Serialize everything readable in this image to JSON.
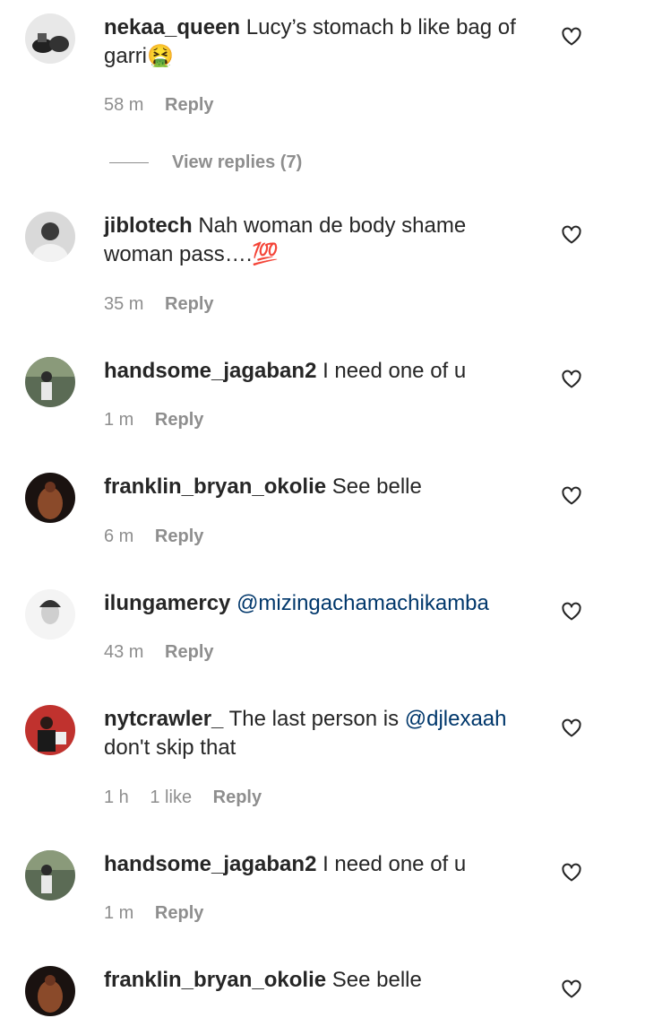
{
  "comments": [
    {
      "username": "nekaa_queen",
      "text": "Lucy’s stomach b like bag of garri🤮",
      "time": "58 m",
      "reply": "Reply"
    },
    {
      "username": "jiblotech",
      "text": "Nah woman de body shame woman pass….💯",
      "time": "35 m",
      "reply": "Reply"
    },
    {
      "username": "handsome_jagaban2",
      "text": "I need one of u",
      "time": "1 m",
      "reply": "Reply"
    },
    {
      "username": "franklin_bryan_okolie",
      "text": "See belle",
      "time": "6 m",
      "reply": "Reply"
    },
    {
      "username": "ilungamercy",
      "mention": "@mizingachamachikamba",
      "time": "43 m",
      "reply": "Reply"
    },
    {
      "username": "nytcrawler_",
      "text": "The last person is",
      "mention": "@djlexaah",
      "text_after": "don't skip that",
      "time": "1 h",
      "likes": "1 like",
      "reply": "Reply"
    },
    {
      "username": "handsome_jagaban2",
      "text": "I need one of u",
      "time": "1 m",
      "reply": "Reply"
    },
    {
      "username": "franklin_bryan_okolie",
      "text": "See belle"
    }
  ],
  "view_replies": "View replies (7)",
  "colors": {
    "text": "#262626",
    "meta": "#8e8e8e",
    "mention": "#00376b"
  },
  "icons": {
    "like": "heart-outline-icon"
  }
}
